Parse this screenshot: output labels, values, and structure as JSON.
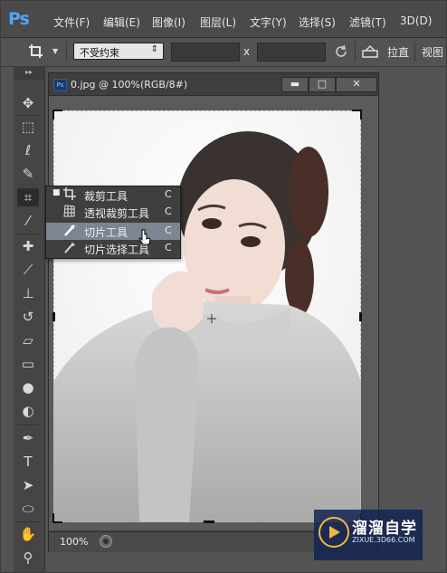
{
  "app": {
    "logo": "Ps"
  },
  "menubar": {
    "items": [
      "文件(F)",
      "编辑(E)",
      "图像(I)",
      "图层(L)",
      "文字(Y)",
      "选择(S)",
      "滤镜(T)",
      "3D(D)"
    ]
  },
  "options_bar": {
    "tool_icon": "crop-icon",
    "ratio_value": "不受约束",
    "x_label": "x",
    "straighten_label": "拉直",
    "view_label": "视图"
  },
  "toolbar": {
    "grip": "▸▸",
    "tools": [
      {
        "name": "move-tool",
        "glyph": "✥"
      },
      {
        "name": "marquee-tool",
        "glyph": "⬚"
      },
      {
        "name": "lasso-tool",
        "glyph": "ℓ"
      },
      {
        "name": "quick-select-tool",
        "glyph": "✎"
      },
      {
        "name": "crop-tool",
        "glyph": "⌗"
      },
      {
        "name": "eyedropper-tool",
        "glyph": "⁄"
      },
      {
        "name": "healing-tool",
        "glyph": "✚"
      },
      {
        "name": "brush-tool",
        "glyph": "⟋"
      },
      {
        "name": "stamp-tool",
        "glyph": "⊥"
      },
      {
        "name": "history-brush-tool",
        "glyph": "↺"
      },
      {
        "name": "eraser-tool",
        "glyph": "▱"
      },
      {
        "name": "gradient-tool",
        "glyph": "▭"
      },
      {
        "name": "blur-tool",
        "glyph": "●"
      },
      {
        "name": "dodge-tool",
        "glyph": "◐"
      },
      {
        "name": "pen-tool",
        "glyph": "✒"
      },
      {
        "name": "type-tool",
        "glyph": "T"
      },
      {
        "name": "path-select-tool",
        "glyph": "➤"
      },
      {
        "name": "shape-tool",
        "glyph": "⬭"
      },
      {
        "name": "hand-tool",
        "glyph": "✋"
      },
      {
        "name": "zoom-tool",
        "glyph": "⚲"
      }
    ]
  },
  "document": {
    "title": "0.jpg @ 100%(RGB/8#)",
    "icon_text": "Ps",
    "minimize": "▬",
    "maximize": "□",
    "close": "✕",
    "zoom": "100%"
  },
  "crop_flyout": {
    "items": [
      {
        "label": "裁剪工具",
        "key": "C",
        "icon": "crop-icon",
        "active": true
      },
      {
        "label": "透视裁剪工具",
        "key": "C",
        "icon": "perspective-crop-icon",
        "active": false
      },
      {
        "label": "切片工具",
        "key": "C",
        "icon": "slice-icon",
        "active": false,
        "hover": true
      },
      {
        "label": "切片选择工具",
        "key": "C",
        "icon": "slice-select-icon",
        "active": false
      }
    ]
  },
  "watermark": {
    "name": "溜溜自学",
    "url": "ZIXUE.3D66.COM"
  }
}
